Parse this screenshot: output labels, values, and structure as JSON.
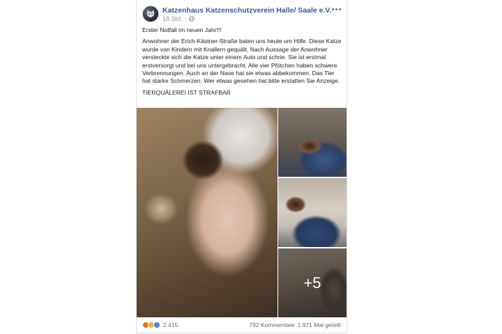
{
  "post": {
    "page_name": "Katzenhaus Katzenschutzverein Halle/ Saale e.V.",
    "time": "18 Std.",
    "privacy_icon": "globe-icon",
    "more_icon": "more-options-icon",
    "paragraphs": [
      "Erster Notfall im neuen Jahr!!!",
      "Anwohner der Erich-Kästner-Straße baten uns heute um Hilfe. Diese Katze wurde von Kindern mit Knallern gequält. Nach Aussage der Anwohner versteckte sich die Katze unter einem Auto und schrie. Sie ist erstmal erstversorgt und bei uns untergebracht. Alle vier Pfötchen haben schwere Verbrennungen. Auch an der Nase hat sie etwas abbekommen. Das Tier hat starke Schmerzen. Wer etwas gesehen hat bitte erstatten Sie Anzeige.",
      "TIERQUÄLEREI IST STRAFBAR"
    ],
    "photos": {
      "more_count": "+5"
    }
  },
  "footer": {
    "reaction_icons": [
      "angry-reaction-icon",
      "sad-reaction-icon",
      "like-reaction-icon"
    ],
    "reaction_count": "2.415",
    "comments": "792 Kommentare",
    "shares": "1.971 Mal geteilt"
  },
  "colors": {
    "link": "#365899",
    "meta": "#90949c",
    "angry": "#e9710f",
    "sad": "#f7b125",
    "like": "#4a7ff0"
  }
}
